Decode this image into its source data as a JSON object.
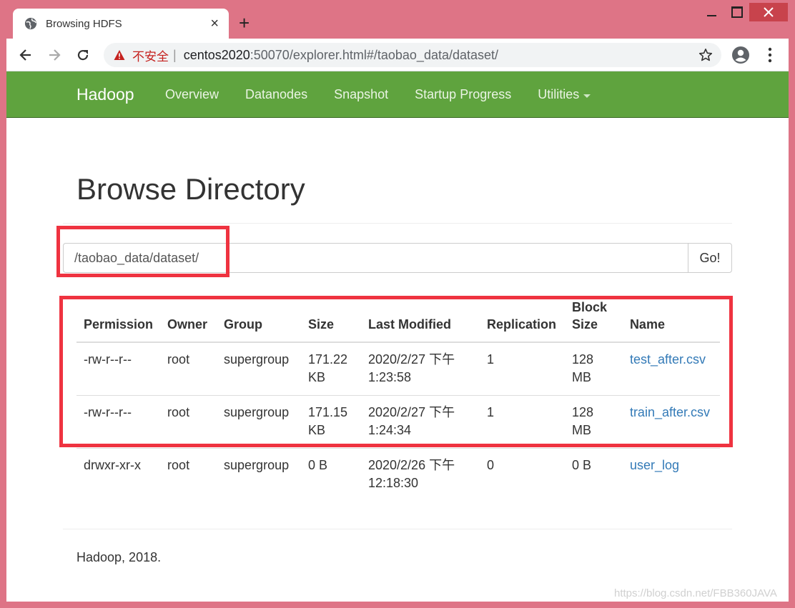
{
  "browser": {
    "tab_title": "Browsing HDFS",
    "insecure_label": "不安全",
    "url_host": "centos2020",
    "url_rest": ":50070/explorer.html#/taobao_data/dataset/"
  },
  "navbar": {
    "brand": "Hadoop",
    "links": [
      "Overview",
      "Datanodes",
      "Snapshot",
      "Startup Progress",
      "Utilities"
    ]
  },
  "page": {
    "title": "Browse Directory",
    "path_value": "/taobao_data/dataset/",
    "go_label": "Go!"
  },
  "table": {
    "headers": [
      "Permission",
      "Owner",
      "Group",
      "Size",
      "Last Modified",
      "Replication",
      "Block Size",
      "Name"
    ],
    "rows": [
      {
        "permission": "-rw-r--r--",
        "owner": "root",
        "group": "supergroup",
        "size": "171.22 KB",
        "modified": "2020/2/27 下午1:23:58",
        "replication": "1",
        "block_size": "128 MB",
        "name": "test_after.csv"
      },
      {
        "permission": "-rw-r--r--",
        "owner": "root",
        "group": "supergroup",
        "size": "171.15 KB",
        "modified": "2020/2/27 下午1:24:34",
        "replication": "1",
        "block_size": "128 MB",
        "name": "train_after.csv"
      },
      {
        "permission": "drwxr-xr-x",
        "owner": "root",
        "group": "supergroup",
        "size": "0 B",
        "modified": "2020/2/26 下午12:18:30",
        "replication": "0",
        "block_size": "0 B",
        "name": "user_log"
      }
    ]
  },
  "footer": {
    "text": "Hadoop, 2018."
  },
  "watermark": "https://blog.csdn.net/FBB360JAVA",
  "colors": {
    "navbar": "#5fa33e",
    "link": "#337ab7",
    "highlight": "#ef3340",
    "window_frame": "#de7486"
  },
  "icons": [
    "globe-icon",
    "close-icon",
    "plus-icon",
    "back-arrow-icon",
    "forward-arrow-icon",
    "reload-icon",
    "warning-icon",
    "star-icon",
    "account-icon",
    "more-vert-icon"
  ]
}
